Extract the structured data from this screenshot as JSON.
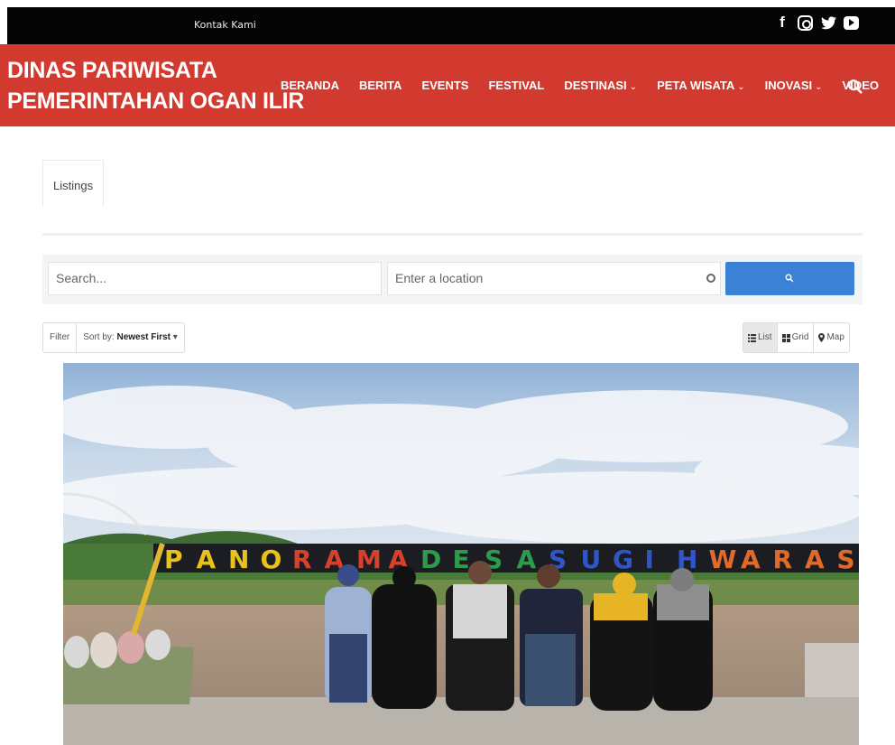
{
  "topbar": {
    "contact_label": "Kontak Kami",
    "social_icons": [
      "facebook-icon",
      "instagram-icon",
      "twitter-icon",
      "youtube-icon"
    ]
  },
  "header": {
    "brand_line1": "DINAS PARIWISATA",
    "brand_line2": "PEMERINTAHAN OGAN ILIR",
    "nav": [
      {
        "label": "BERANDA",
        "has_dropdown": false
      },
      {
        "label": "BERITA",
        "has_dropdown": false
      },
      {
        "label": "EVENTS",
        "has_dropdown": false
      },
      {
        "label": "FESTIVAL",
        "has_dropdown": false
      },
      {
        "label": "DESTINASI",
        "has_dropdown": true
      },
      {
        "label": "PETA WISATA",
        "has_dropdown": true
      },
      {
        "label": "INOVASI",
        "has_dropdown": true
      },
      {
        "label": "VIDEO",
        "has_dropdown": false
      }
    ],
    "caret": "⌄"
  },
  "listings": {
    "tab_label": "Listings",
    "search_placeholder": "Search...",
    "location_placeholder": "Enter a location",
    "filter_label": "Filter",
    "sort_prefix": "Sort by:",
    "sort_value": "Newest First",
    "views": [
      {
        "label": "List",
        "icon": "list-icon",
        "active": true
      },
      {
        "label": "Grid",
        "icon": "grid-icon",
        "active": false
      },
      {
        "label": "Map",
        "icon": "map-pin-icon",
        "active": false
      }
    ]
  },
  "photo": {
    "sign_letters": [
      "P",
      "A",
      "N",
      "O",
      "R",
      "A",
      "M",
      "A",
      "D",
      "E",
      "S",
      "A",
      "S",
      "U",
      "G",
      "I",
      "H",
      "W",
      "A",
      "R",
      "A",
      "S"
    ],
    "sign_colors": [
      "#e8c21a",
      "#e8c21a",
      "#e8c21a",
      "#e8c21a",
      "#d8402c",
      "#d8402c",
      "#d8402c",
      "#d8402c",
      "#2f9a4c",
      "#2f9a4c",
      "#2f9a4c",
      "#2f9a4c",
      "#2f56c8",
      "#2f56c8",
      "#2f56c8",
      "#2f56c8",
      "#2f56c8",
      "#e06a2a",
      "#e06a2a",
      "#e06a2a",
      "#e06a2a",
      "#e06a2a"
    ]
  },
  "colors": {
    "topbar": "#050505",
    "navbar": "#d23a2f",
    "search_button": "#3b82d6"
  }
}
